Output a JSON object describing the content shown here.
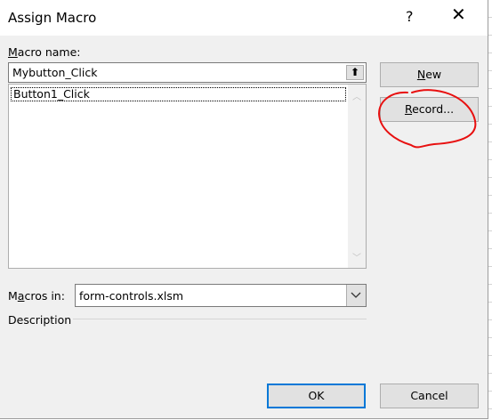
{
  "dialog": {
    "title": "Assign Macro",
    "help_symbol": "?",
    "close_symbol": "✕"
  },
  "macro_name": {
    "label_accel": "M",
    "label_rest": "acro name:",
    "value": "Mybutton_Click",
    "up_arrow": "⬆",
    "list": [
      "Button1_Click"
    ]
  },
  "buttons": {
    "new_accel": "N",
    "new_rest": "ew",
    "record_accel": "R",
    "record_rest": "ecord...",
    "ok": "OK",
    "cancel": "Cancel"
  },
  "macros_in": {
    "label_pre": "M",
    "label_accel": "a",
    "label_rest": "cros in:",
    "value": "form-controls.xlsm"
  },
  "description_label": "Description",
  "annotation": {
    "color": "#e81010"
  }
}
